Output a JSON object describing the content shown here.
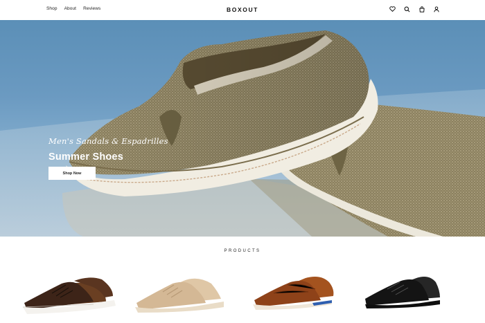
{
  "header": {
    "nav": [
      "Shop",
      "About",
      "Reviews"
    ],
    "brand": "BOXOUT",
    "icons": [
      "heart-icon",
      "search-icon",
      "bag-icon",
      "user-icon"
    ]
  },
  "hero": {
    "subtitle": "Men's Sandals & Espadrilles",
    "title": "Summer Shoes",
    "button": "Shop Now"
  },
  "products": {
    "heading": "PRODUCTS",
    "items": [
      {
        "image": "brown suede and leather sneakers",
        "color": "#5a3a26"
      },
      {
        "image": "beige suede sneakers",
        "color": "#d7bd9b"
      },
      {
        "image": "tan leather sneakers",
        "color": "#9d4a1f"
      },
      {
        "image": "black leather sneakers",
        "color": "#1c1c1c"
      }
    ]
  },
  "colors": {
    "accent": "#ffffff",
    "hero_bg": "#6b9ac1",
    "text": "#1a1a1a"
  }
}
